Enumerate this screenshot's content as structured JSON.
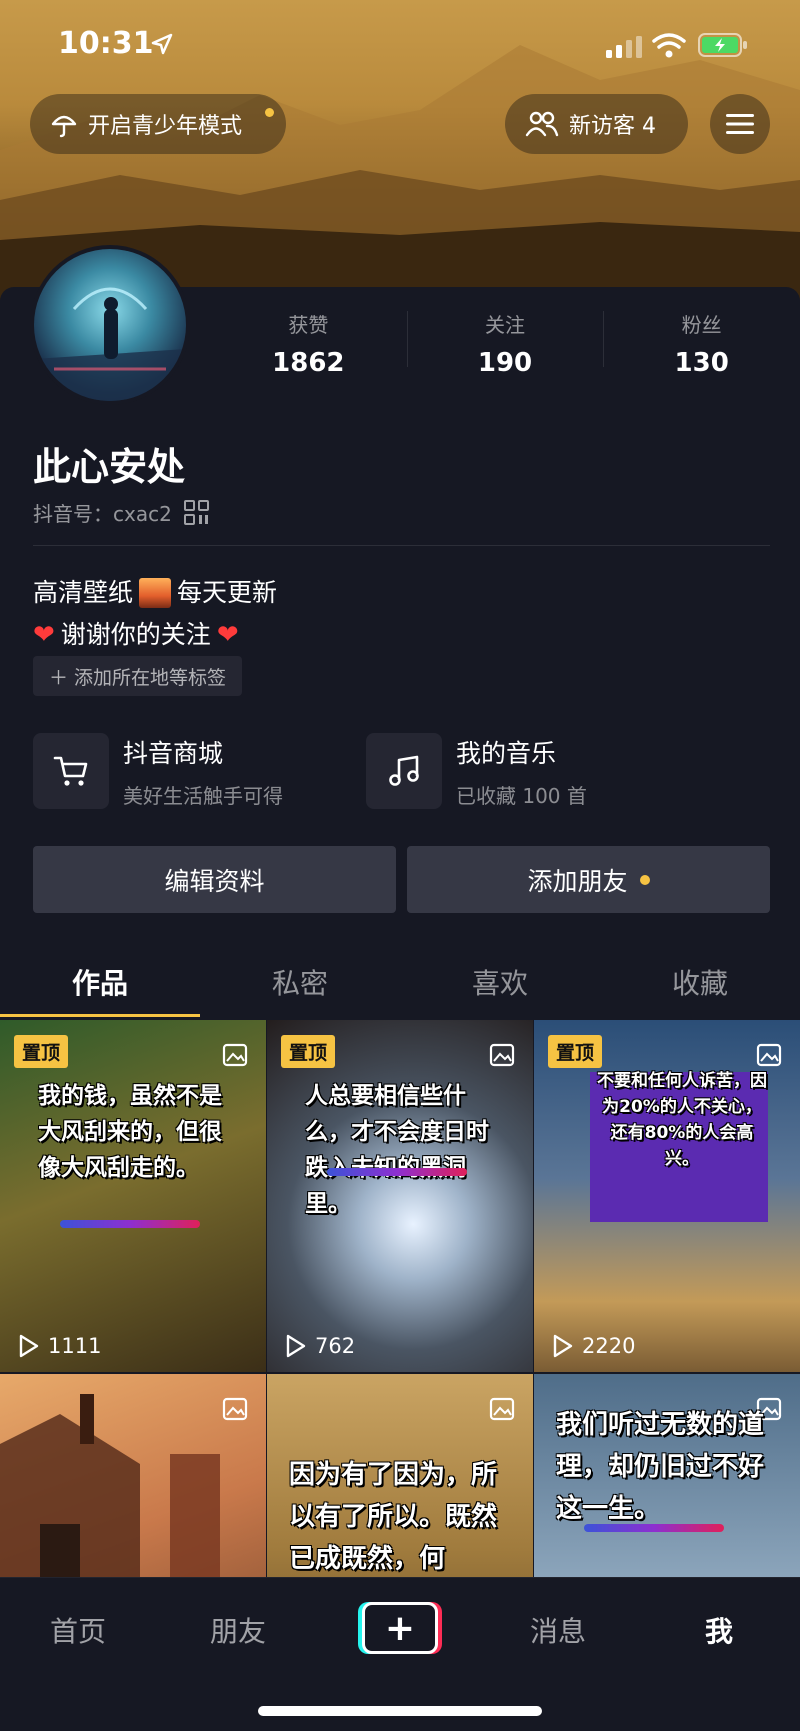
{
  "status_bar": {
    "time": "10:31"
  },
  "header": {
    "teen_mode_label": "开启青少年模式",
    "new_visitors_label": "新访客 4"
  },
  "profile": {
    "nickname": "此心安处",
    "douyin_id": "抖音号：cxac2",
    "stats": [
      {
        "label": "获赞",
        "value": "1862"
      },
      {
        "label": "关注",
        "value": "190"
      },
      {
        "label": "粉丝",
        "value": "130"
      }
    ],
    "bio_line1": "高清壁纸",
    "bio_line1_suffix": "每天更新",
    "bio_line2": "谢谢你的关注",
    "add_tag_label": "添加所在地等标签"
  },
  "services": {
    "mall": {
      "title": "抖音商城",
      "subtitle": "美好生活触手可得"
    },
    "music": {
      "title": "我的音乐",
      "subtitle": "已收藏 100 首"
    }
  },
  "actions": {
    "edit_label": "编辑资料",
    "add_friend_label": "添加朋友"
  },
  "tabs": [
    {
      "label": "作品",
      "active": true
    },
    {
      "label": "私密",
      "active": false
    },
    {
      "label": "喜欢",
      "active": false
    },
    {
      "label": "收藏",
      "active": false
    }
  ],
  "videos": [
    {
      "pinned_label": "置顶",
      "caption": "我的钱，虽然不是大风刮来的，但很像大风刮走的。",
      "plays": "1111"
    },
    {
      "pinned_label": "置顶",
      "caption": "人总要相信些什么，才不会度日时跌入未知的黑洞里。",
      "plays": "762"
    },
    {
      "pinned_label": "置顶",
      "caption": "不要和任何人诉苦，因为20%的人不关心，还有80%的人会高兴。",
      "plays": "2220"
    },
    {
      "caption": ""
    },
    {
      "caption": "因为有了因为，所以有了所以。既然已成既然，何"
    },
    {
      "caption": "我们听过无数的道理，却仍旧过不好这一生。"
    }
  ],
  "bottom_nav": {
    "home": "首页",
    "friends": "朋友",
    "plus": "+",
    "messages": "消息",
    "me": "我"
  },
  "colors": {
    "accent": "#f6c343",
    "background": "#161823",
    "button": "#363845"
  }
}
